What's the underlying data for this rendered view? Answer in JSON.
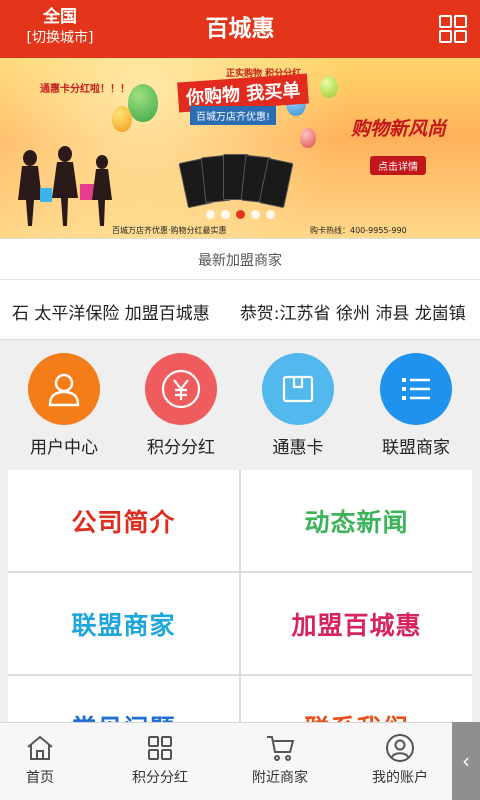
{
  "header": {
    "city_name": "全国",
    "city_switch": "[切换城市]",
    "title": "百城惠",
    "menu_icon": "grid-icon"
  },
  "banner": {
    "tag": "通惠卡分红啦！！！",
    "headline_top": "正实购物 积分分红",
    "headline": "你购物  我买单",
    "headline_sub": "百城万店齐优惠!",
    "right_text": "购物新风尚",
    "detail_button": "点击详情",
    "footer": "百城万店齐优惠·购物分红最实惠",
    "hotline": "购卡热线：400-9955-990",
    "active_slide": 3,
    "slide_count": 5
  },
  "news": {
    "title": "最新加盟商家",
    "items": [
      "石 太平洋保险 加盟百城惠",
      "恭贺:江苏省 徐州 沛县 龙崮镇"
    ]
  },
  "quick_links": [
    {
      "label": "用户中心",
      "icon": "user-icon",
      "color": "#f47d17"
    },
    {
      "label": "积分分红",
      "icon": "yen-icon",
      "color": "#f05c5e"
    },
    {
      "label": "通惠卡",
      "icon": "wallet-icon",
      "color": "#52b8ee"
    },
    {
      "label": "联盟商家",
      "icon": "list-icon",
      "color": "#1e92ec"
    }
  ],
  "grid": [
    {
      "label": "公司简介",
      "color": "#dd2d1e"
    },
    {
      "label": "动态新闻",
      "color": "#3db35a"
    },
    {
      "label": "联盟商家",
      "color": "#1fa6dd"
    },
    {
      "label": "加盟百城惠",
      "color": "#d6245e"
    },
    {
      "label": "常见问题",
      "color": "#1f6fd0"
    },
    {
      "label": "联系我们",
      "color": "#e8521a"
    }
  ],
  "bottom_nav": [
    {
      "label": "首页",
      "icon": "home-icon"
    },
    {
      "label": "积分分红",
      "icon": "apps-icon"
    },
    {
      "label": "附近商家",
      "icon": "cart-icon"
    },
    {
      "label": "我的账户",
      "icon": "account-icon"
    }
  ],
  "side_tab": "‹",
  "colors": {
    "brand": "#e4351b"
  }
}
